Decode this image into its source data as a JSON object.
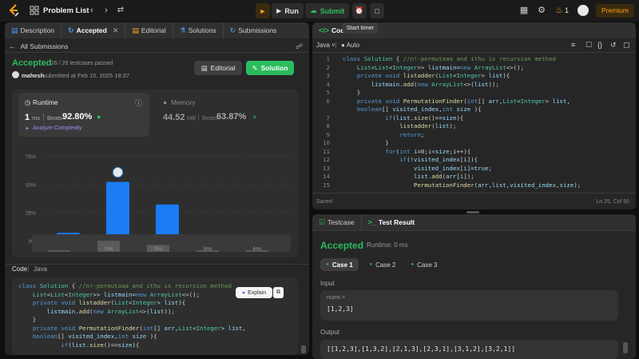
{
  "topbar": {
    "title": "Problem List",
    "run": "Run",
    "submit": "Submit",
    "streak": "1",
    "premium": "Premium"
  },
  "tooltip": "Start timer",
  "left_tabs": [
    {
      "label": "Description",
      "icon": "document-icon"
    },
    {
      "label": "Accepted",
      "icon": "history-icon",
      "active": true,
      "closable": true
    },
    {
      "label": "Editorial",
      "icon": "book-icon"
    },
    {
      "label": "Solutions",
      "icon": "flask-icon"
    },
    {
      "label": "Submissions",
      "icon": "clock-icon"
    }
  ],
  "submissions_link": "All Submissions",
  "result": {
    "status": "Accepted",
    "testcases": "26 / 26 testcases passed",
    "user": "mahesh",
    "submitted": "submitted at Feb 15, 2025 18:37",
    "editorial_btn": "Editorial",
    "solution_btn": "Solution"
  },
  "runtime": {
    "label": "Runtime",
    "value": "1",
    "unit": "ms",
    "beats_label": "Beats",
    "beats": "92.80%",
    "analyze": "Analyze Complexity"
  },
  "memory": {
    "label": "Memory",
    "value": "44.52",
    "unit": "MB",
    "beats_label": "Beats",
    "beats": "63.87%"
  },
  "chart_data": {
    "type": "bar",
    "y_ticks": [
      "75%",
      "50%",
      "25%",
      "0%"
    ],
    "ylim": [
      0,
      75
    ],
    "x_labels": [
      "1ms",
      "2ms",
      "3ms",
      "4ms"
    ],
    "values": [
      7,
      52,
      32,
      2.5,
      2.5
    ],
    "highlight_index": 1,
    "bar_color": "#1a7cf5",
    "mini_labels": [
      "1ms",
      "2ms",
      "3ms",
      "4ms"
    ]
  },
  "code_section": {
    "label": "Code",
    "lang": "Java",
    "explain": "Explain"
  },
  "left_code": [
    "class Solution { //n!-permutaaa and ithu is recursion method",
    "    List<List<Integer>> listmain=new ArrayList<>();",
    "    private void listadder(List<Integer> list){",
    "        listmain.add(new ArrayList<>(list));",
    "    }",
    "    private void PermutationFinder(int[] arr,List<Integer> list,",
    "    boolean[] visited_index,int size ){",
    "            if(list.size()==size){"
  ],
  "editor": {
    "title": "Code",
    "lang": "Java",
    "mode": "Auto",
    "saved": "Saved",
    "cursor": "Ln 25, Col 50"
  },
  "editor_lines": [
    {
      "n": "1",
      "t": "class Solution { //n!-permutaaa and ithu is recursion method"
    },
    {
      "n": "2",
      "t": "    List<List<Integer>> listmain=new ArrayList<>();"
    },
    {
      "n": "3",
      "t": "    private void listadder(List<Integer> list){"
    },
    {
      "n": "4",
      "t": "        listmain.add(new ArrayList<>(list));"
    },
    {
      "n": "5",
      "t": "    }"
    },
    {
      "n": "6",
      "t": "    private void PermutationFinder(int[] arr,List<Integer> list,"
    },
    {
      "n": "",
      "t": "    boolean[] visited_index,int size ){"
    },
    {
      "n": "7",
      "t": "            if(list.size()==size){"
    },
    {
      "n": "8",
      "t": "                listadder(list);"
    },
    {
      "n": "9",
      "t": "                return;"
    },
    {
      "n": "10",
      "t": "            }"
    },
    {
      "n": "11",
      "t": "            for(int i=0;i<size;i++){"
    },
    {
      "n": "12",
      "t": "                if(!visited_index[i]){"
    },
    {
      "n": "13",
      "t": "                    visited_index[i]=true;"
    },
    {
      "n": "14",
      "t": "                    list.add(arr[i]);"
    },
    {
      "n": "15",
      "t": "                    PermutationFinder(arr,list,visited_index,size);"
    }
  ],
  "bottom_tabs": {
    "testcase": "Testcase",
    "result": "Test Result"
  },
  "test": {
    "status": "Accepted",
    "runtime": "Runtime: 0 ms",
    "cases": [
      "Case 1",
      "Case 2",
      "Case 3"
    ],
    "input_label": "Input",
    "var": "nums =",
    "input_value": "[1,2,3]",
    "output_label": "Output",
    "output_value": "[[1,2,3],[1,3,2],[2,1,3],[2,3,1],[3,1,2],[3,2,1]]"
  }
}
